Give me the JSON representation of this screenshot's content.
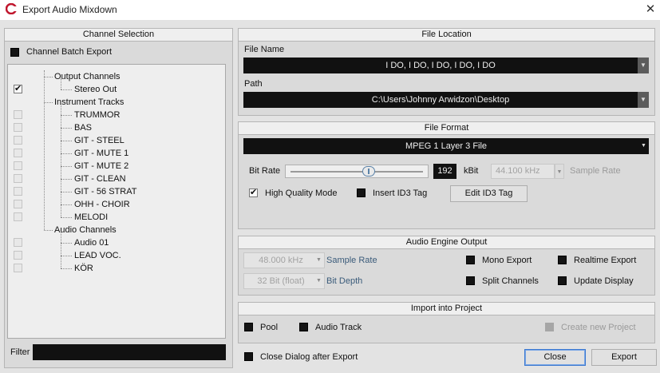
{
  "window": {
    "title": "Export Audio Mixdown",
    "close_icon": "close-icon"
  },
  "channel_selection": {
    "header": "Channel Selection",
    "batch_export_label": "Channel Batch Export",
    "batch_export_checked": false,
    "groups": [
      {
        "label": "Output Channels",
        "items": [
          {
            "label": "Stereo Out",
            "checked": true
          }
        ]
      },
      {
        "label": "Instrument Tracks",
        "items": [
          {
            "label": "TRUMMOR",
            "checked": false
          },
          {
            "label": "BAS",
            "checked": false
          },
          {
            "label": "GIT - STEEL",
            "checked": false
          },
          {
            "label": "GIT - MUTE 1",
            "checked": false
          },
          {
            "label": "GIT - MUTE 2",
            "checked": false
          },
          {
            "label": "GIT - CLEAN",
            "checked": false
          },
          {
            "label": "GIT - 56 STRAT",
            "checked": false
          },
          {
            "label": "OHH - CHOIR",
            "checked": false
          },
          {
            "label": "MELODI",
            "checked": false
          }
        ]
      },
      {
        "label": "Audio Channels",
        "items": [
          {
            "label": "Audio 01",
            "checked": false
          },
          {
            "label": "LEAD VOC.",
            "checked": false
          },
          {
            "label": "KÖR",
            "checked": false
          }
        ]
      }
    ],
    "filter_label": "Filter",
    "filter_value": ""
  },
  "file_location": {
    "header": "File Location",
    "file_name_label": "File Name",
    "file_name_value": "I DO, I DO, I DO, I DO, I DO",
    "path_label": "Path",
    "path_value": "C:\\Users\\Johnny Arwidzon\\Desktop"
  },
  "file_format": {
    "header": "File Format",
    "format_value": "MPEG 1 Layer 3 File",
    "bitrate_label": "Bit Rate",
    "bitrate_value": "192",
    "bitrate_unit": "kBit",
    "bitrate_slider_fraction": 0.6,
    "sample_rate_value": "44.100 kHz",
    "sample_rate_label": "Sample Rate",
    "high_quality_label": "High Quality Mode",
    "high_quality_checked": true,
    "insert_id3_label": "Insert ID3 Tag",
    "insert_id3_checked": false,
    "edit_id3_label": "Edit ID3 Tag"
  },
  "audio_engine": {
    "header": "Audio Engine Output",
    "sample_rate_value": "48.000 kHz",
    "sample_rate_label": "Sample Rate",
    "bit_depth_value": "32 Bit (float)",
    "bit_depth_label": "Bit Depth",
    "mono_export_label": "Mono Export",
    "split_channels_label": "Split Channels",
    "realtime_export_label": "Realtime Export",
    "update_display_label": "Update Display"
  },
  "import_project": {
    "header": "Import into Project",
    "pool_label": "Pool",
    "audio_track_label": "Audio Track",
    "create_new_project_label": "Create new Project"
  },
  "footer": {
    "close_dialog_label": "Close Dialog after Export",
    "close_button": "Close",
    "export_button": "Export"
  },
  "colors": {
    "accent": "#3b78d0",
    "logo": "#c0162d"
  }
}
